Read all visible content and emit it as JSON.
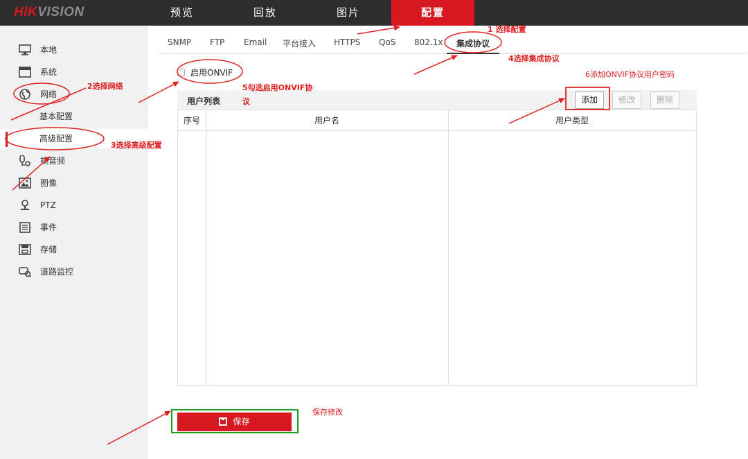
{
  "brand": {
    "logo_red": "HIK",
    "logo_gray": "VISION"
  },
  "topnav": [
    {
      "label": "预览"
    },
    {
      "label": "回放"
    },
    {
      "label": "图片"
    },
    {
      "label": "配置",
      "active": true
    }
  ],
  "sidebar": {
    "items": [
      {
        "label": "本地",
        "icon": "monitor-icon"
      },
      {
        "label": "系统",
        "icon": "window-icon"
      },
      {
        "label": "网络",
        "icon": "globe-icon"
      },
      {
        "label": "基本配置",
        "sub": true
      },
      {
        "label": "高级配置",
        "sub": true,
        "active": true
      },
      {
        "label": "视音频",
        "icon": "mic-icon"
      },
      {
        "label": "图像",
        "icon": "image-icon"
      },
      {
        "label": "PTZ",
        "icon": "ptz-icon"
      },
      {
        "label": "事件",
        "icon": "event-icon"
      },
      {
        "label": "存储",
        "icon": "storage-icon"
      },
      {
        "label": "道路监控",
        "icon": "road-monitor-icon"
      }
    ]
  },
  "tabs": [
    {
      "label": "SNMP"
    },
    {
      "label": "FTP"
    },
    {
      "label": "Email"
    },
    {
      "label": "平台接入"
    },
    {
      "label": "HTTPS"
    },
    {
      "label": "QoS"
    },
    {
      "label": "802.1x"
    },
    {
      "label": "集成协议",
      "active": true
    }
  ],
  "onvif": {
    "label": "启用ONVIF",
    "checked": false
  },
  "user_list": {
    "title": "用户列表",
    "buttons": {
      "add": "添加",
      "edit": "修改",
      "delete": "删除"
    },
    "columns": [
      "序号",
      "用户名",
      "用户类型"
    ],
    "rows": []
  },
  "save": {
    "label": "保存"
  },
  "annotations": {
    "a1": "1 选择配置",
    "a2": "2选择网络",
    "a3": "3选择高级配置",
    "a4": "4选择集成协议",
    "a5_line1": "5勾选启用ONVIF协",
    "a5_line2": "议",
    "a6": "6添加ONVIF协议用户密码",
    "a_save": "保存修改"
  },
  "colors": {
    "accent": "#d71820",
    "topbar": "#2d2d2d",
    "sidebar": "#f1f1f1",
    "annotation": "#e02020",
    "highlight_green": "#1aa01a"
  }
}
